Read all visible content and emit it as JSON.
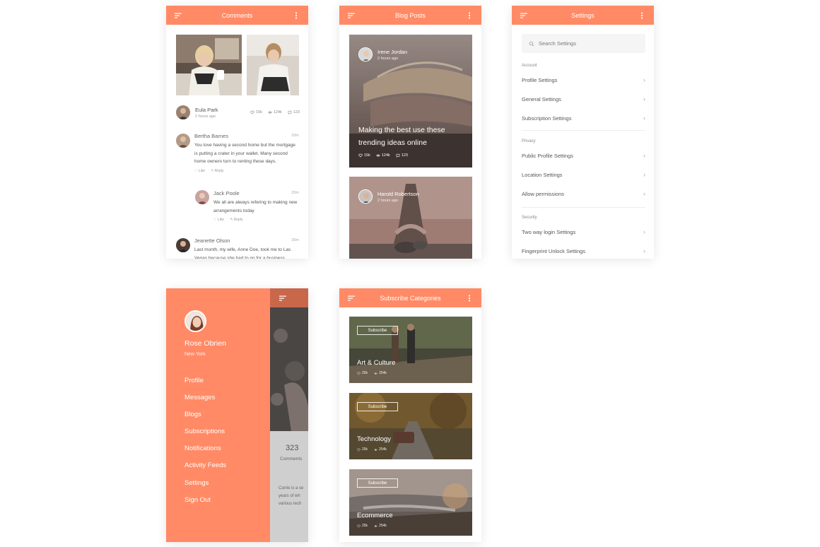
{
  "colors": {
    "accent": "#FF8A65",
    "text": "#555555",
    "muted": "#999999"
  },
  "comments_screen": {
    "title": "Comments",
    "author": {
      "name": "Eula Park",
      "time": "2 hours ago",
      "likes": "15k",
      "views": "124k",
      "comments": "123"
    },
    "comments": [
      {
        "name": "Bertha Barnes",
        "time": "20m",
        "text": "You love having a second home but the mortgage is putting a crater in your wallet. Many second home owners turn to renting these days.",
        "like": "Like",
        "reply": "Reply"
      },
      {
        "name": "Jack Poole",
        "time": "20m",
        "text": "We all are always refering to making new arrangements today",
        "like": "Like",
        "reply": "Reply"
      },
      {
        "name": "Jeanette Olson",
        "time": "30m",
        "text": "Last month, my wife, Anne Doe, took me to Las Vegas because she had to go for a business"
      }
    ]
  },
  "blog_screen": {
    "title": "Blog Posts",
    "posts": [
      {
        "author": "Irene Jordan",
        "time": "2 hours ago",
        "headline": "Making the best use these trending ideas online",
        "likes": "15k",
        "views": "124k",
        "comments": "123"
      },
      {
        "author": "Harold Robertson",
        "time": "2 hours ago"
      }
    ]
  },
  "settings_screen": {
    "title": "Settings",
    "search_placeholder": "Search Settings",
    "sections": [
      {
        "heading": "Account",
        "items": [
          "Profile Settings",
          "General Settings",
          "Subscription Settings"
        ]
      },
      {
        "heading": "Privacy",
        "items": [
          "Public Profile Settings",
          "Location Settings",
          "Allow permissions"
        ]
      },
      {
        "heading": "Security",
        "items": [
          "Two way login Settings",
          "Fingerprint Unlock Settings"
        ]
      }
    ]
  },
  "drawer_screen": {
    "user_name": "Rose Obrien",
    "user_location": "New York",
    "menu": [
      "Profile",
      "Messages",
      "Blogs",
      "Subscriptions",
      "Notifications",
      "Activity Feeds",
      "Settings",
      "Sign Out"
    ],
    "behind": {
      "count": "323",
      "count_label": "Comments",
      "snippet": "Carrie is a se years of wh various tech"
    }
  },
  "categories_screen": {
    "title": "Subscribe Categories",
    "categories": [
      {
        "name": "Art & Culture",
        "button": "Subscribe",
        "likes": "25k",
        "views": "254k"
      },
      {
        "name": "Technology",
        "button": "Subscribe",
        "likes": "25k",
        "views": "254k"
      },
      {
        "name": "Ecommerce",
        "button": "Subscribe",
        "likes": "25k",
        "views": "254k"
      }
    ]
  }
}
